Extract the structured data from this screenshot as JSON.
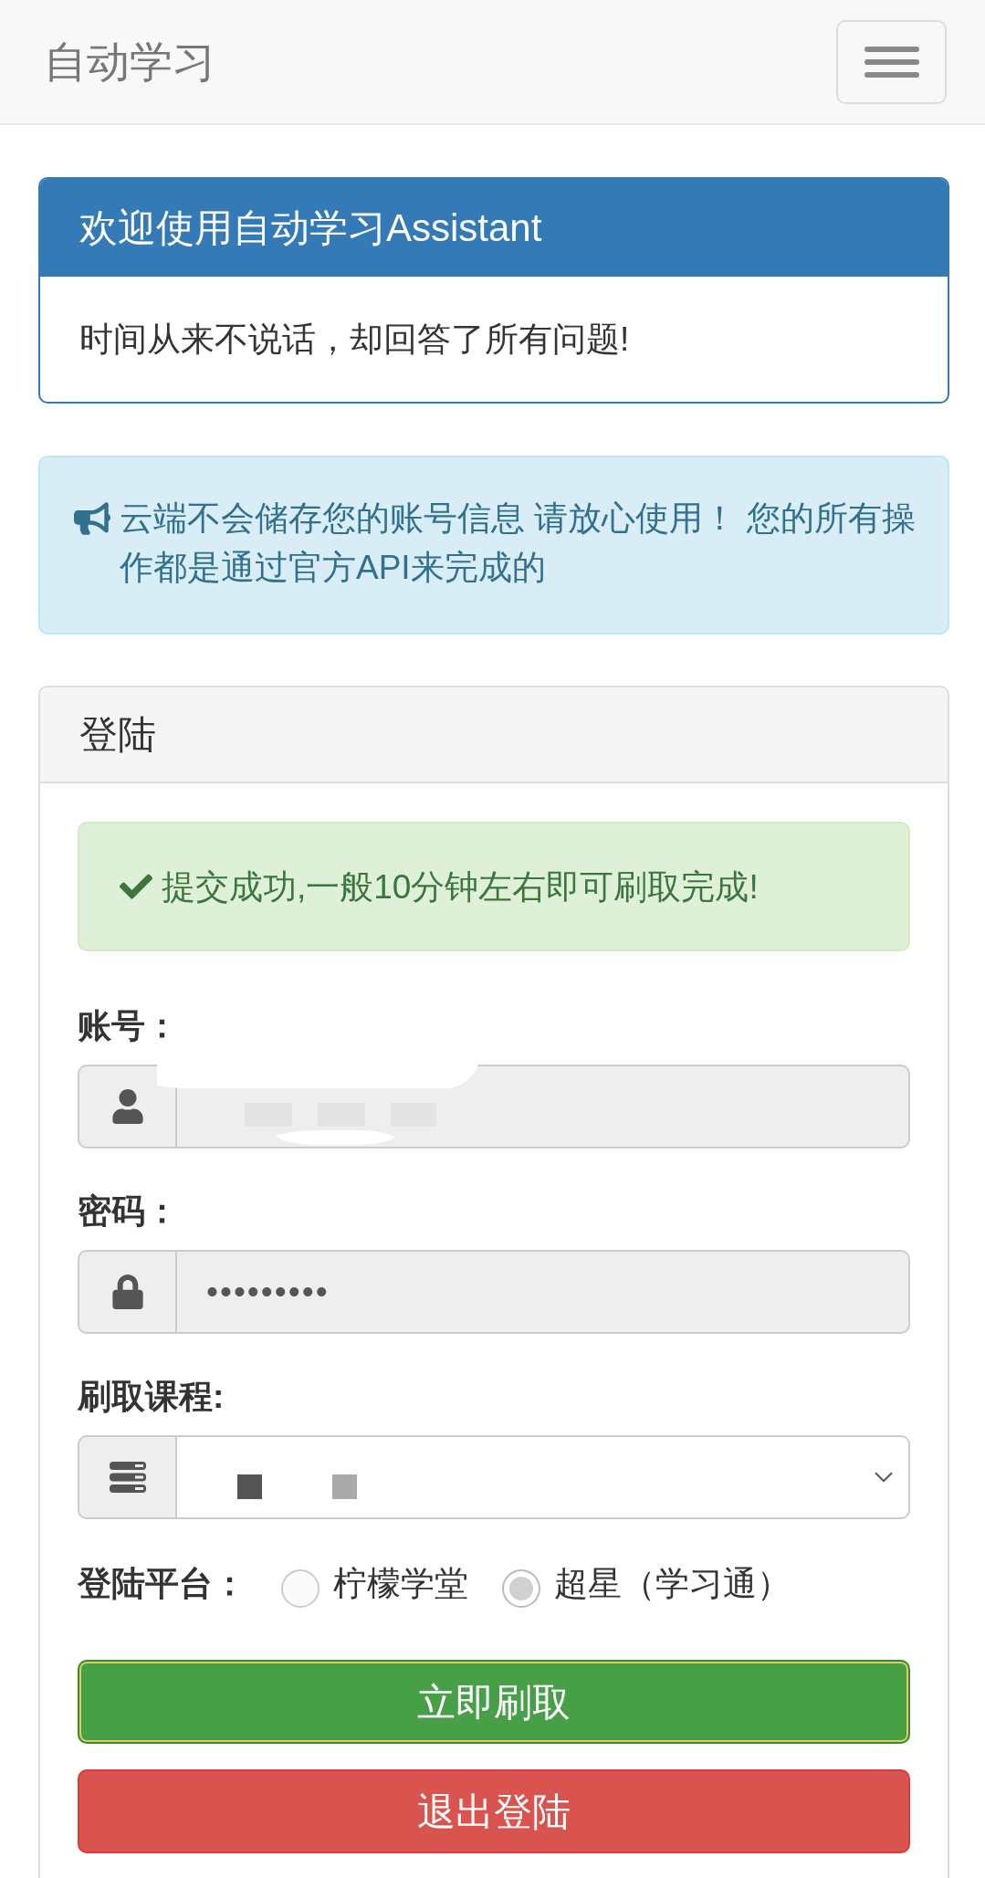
{
  "navbar": {
    "brand": "自动学习"
  },
  "welcome_panel": {
    "title": "欢迎使用自动学习Assistant",
    "body": "时间从来不说话，却回答了所有问题!"
  },
  "notice": {
    "text": "云端不会储存您的账号信息 请放心使用！ 您的所有操作都是通过官方API来完成的"
  },
  "login_panel": {
    "title": "登陆",
    "success_message": "提交成功,一般10分钟左右即可刷取完成!",
    "fields": [
      {
        "kind": "text",
        "label": "账号：",
        "redacted": true
      },
      {
        "kind": "password",
        "label": "密码：",
        "value": "•••••••••"
      },
      {
        "kind": "select",
        "label": "刷取课程:",
        "redacted": true
      }
    ],
    "platform": {
      "label": "登陆平台：",
      "options": [
        {
          "label": "柠檬学堂",
          "selected": false
        },
        {
          "label": "超星（学习通）",
          "selected": true
        }
      ]
    },
    "buttons": [
      {
        "kind": "success",
        "label": "立即刷取",
        "focused": true
      },
      {
        "kind": "danger",
        "label": "退出登陆",
        "focused": false
      }
    ]
  }
}
